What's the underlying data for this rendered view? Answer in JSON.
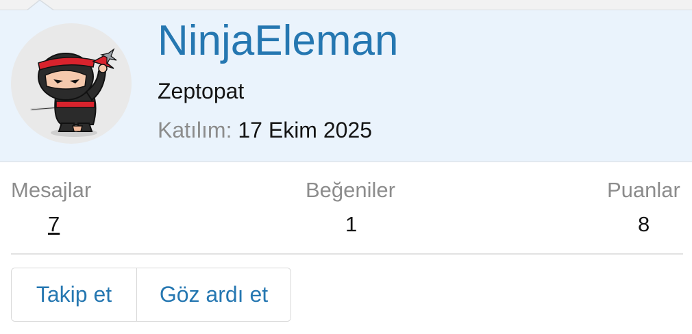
{
  "profile": {
    "username": "NinjaEleman",
    "user_title": "Zeptopat",
    "joined_label": "Katılım:",
    "joined_value": "17 Ekim 2025",
    "avatar_icon": "ninja-avatar"
  },
  "stats": {
    "messages_label": "Mesajlar",
    "messages_value": "7",
    "likes_label": "Beğeniler",
    "likes_value": "1",
    "points_label": "Puanlar",
    "points_value": "8"
  },
  "actions": {
    "follow_label": "Takip et",
    "ignore_label": "Göz ardı et"
  },
  "colors": {
    "accent": "#2577b1",
    "header_bg": "#eaf3fc",
    "muted_text": "#8c8c8c"
  }
}
